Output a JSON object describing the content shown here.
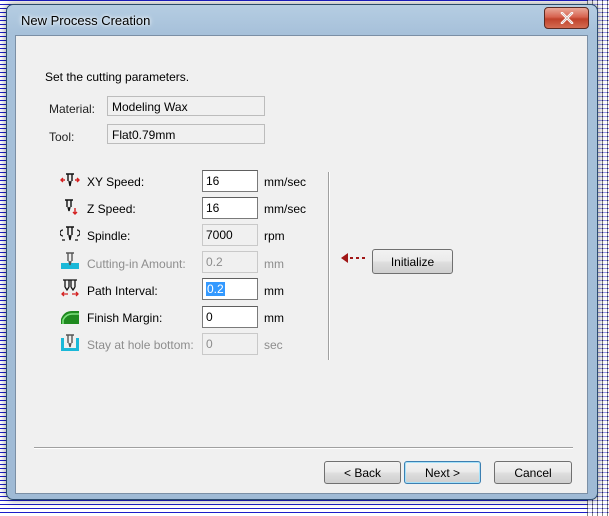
{
  "window": {
    "title": "New Process Creation"
  },
  "heading": "Set the cutting parameters.",
  "material": {
    "label": "Material:",
    "value": "Modeling Wax"
  },
  "tool": {
    "label": "Tool:",
    "value": "Flat0.79mm"
  },
  "params": [
    {
      "label": "XY Speed:",
      "value": "16",
      "unit": "mm/sec",
      "icon": "xy-speed-icon",
      "state": "editable"
    },
    {
      "label": "Z Speed:",
      "value": "16",
      "unit": "mm/sec",
      "icon": "z-speed-icon",
      "state": "editable"
    },
    {
      "label": "Spindle:",
      "value": "7000",
      "unit": "rpm",
      "icon": "spindle-icon",
      "state": "readonly"
    },
    {
      "label": "Cutting-in Amount:",
      "value": "0.2",
      "unit": "mm",
      "icon": "cutting-in-icon",
      "state": "disabled"
    },
    {
      "label": "Path Interval:",
      "value": "0.2",
      "unit": "mm",
      "icon": "path-interval-icon",
      "state": "selected"
    },
    {
      "label": "Finish Margin:",
      "value": "0",
      "unit": "mm",
      "icon": "finish-margin-icon",
      "state": "editable"
    },
    {
      "label": "Stay at hole bottom:",
      "value": "0",
      "unit": "sec",
      "icon": "stay-hole-icon",
      "state": "disabled"
    }
  ],
  "initialize_label": "Initialize",
  "footer": {
    "back_label": "< Back",
    "next_label": "Next >",
    "cancel_label": "Cancel"
  },
  "colors": {
    "accent_red": "#a01616",
    "icon_red": "#d42020",
    "icon_cyan": "#1ab8d8",
    "icon_green": "#2aa02a",
    "selection": "#3399ff"
  }
}
